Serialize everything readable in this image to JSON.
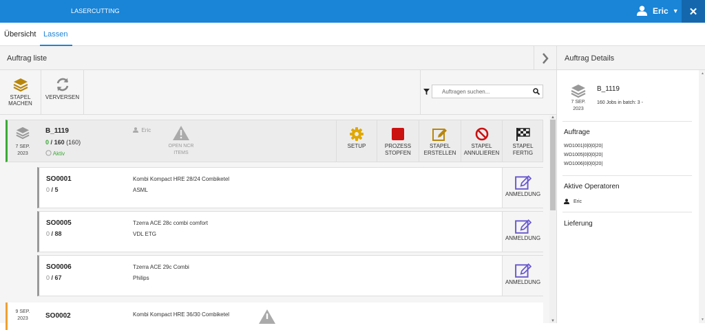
{
  "app": {
    "title": "LASERCUTTING",
    "user": "Eric",
    "caret": "▼",
    "close": "✕"
  },
  "tabs": {
    "overview": "Übersicht",
    "lassen": "Lassen"
  },
  "left": {
    "title": "Auftrag liste",
    "chevron": "❯"
  },
  "toolbar": {
    "stapel_machen": [
      "STAPEL",
      "MACHEN"
    ],
    "verversen": "VERVERSEN",
    "search_placeholder": "Auftragen suchen..."
  },
  "batch": {
    "id": "B_1119",
    "date": [
      "7 SEP.",
      "2023"
    ],
    "done": "0",
    "total": "160",
    "extra": "(160)",
    "status": "Aktiv",
    "operator": "Eric",
    "ncr": [
      "OPEN NCR",
      "ITEMS"
    ],
    "actions": [
      {
        "label": [
          "SETUP",
          ""
        ],
        "icon": "gear-icon",
        "color": "#e0a800"
      },
      {
        "label": [
          "PROZESS",
          "STOPFEN"
        ],
        "icon": "stop-icon",
        "color": "#cc1111"
      },
      {
        "label": [
          "STAPEL",
          "ERSTELLEN"
        ],
        "icon": "edit-icon",
        "color": "#b8860b"
      },
      {
        "label": [
          "STAPEL",
          "ANNULIEREN"
        ],
        "icon": "ban-icon",
        "color": "#cc1111"
      },
      {
        "label": [
          "STAPEL",
          "FERTIG"
        ],
        "icon": "checkered-flag-icon",
        "color": "#222"
      }
    ]
  },
  "jobs": [
    {
      "id": "SO0001",
      "done": "0",
      "qty": "5",
      "name": "Kombi Kompact HRE 28/24 Combiketel",
      "customer": "ASML",
      "button": "ANMELDUNG"
    },
    {
      "id": "SO0005",
      "done": "0",
      "qty": "88",
      "name": "Tzerra ACE 28c combi comfort",
      "customer": "VDL ETG",
      "button": "ANMELDUNG"
    },
    {
      "id": "SO0006",
      "done": "0",
      "qty": "67",
      "name": "Tzerra ACE 29c Combi",
      "customer": "Philips",
      "button": "ANMELDUNG"
    }
  ],
  "batch2": {
    "id": "SO0002",
    "date": [
      "9 SEP.",
      "2023"
    ],
    "name": "Kombi Kompact HRE 36/30 Combiketel"
  },
  "right": {
    "title": "Auftrag Details",
    "batch_id": "B_1119",
    "date": [
      "7 SEP.",
      "2023"
    ],
    "jobs_text": "160 Jobs in batch: 3 -",
    "auftrage_title": "Auftrage",
    "auftrage": [
      "WO1001|0|0|0|20|",
      "WO1005|0|0|0|20|",
      "WO1006|0|0|0|20|"
    ],
    "operators_title": "Aktive Operatoren",
    "operator": "Eric",
    "lieferung_title": "Lieferung"
  },
  "colors": {
    "primary": "#1a84d6",
    "active_green": "#3aaa35",
    "pending_orange": "#f0a030",
    "icon_gold": "#b8860b"
  }
}
